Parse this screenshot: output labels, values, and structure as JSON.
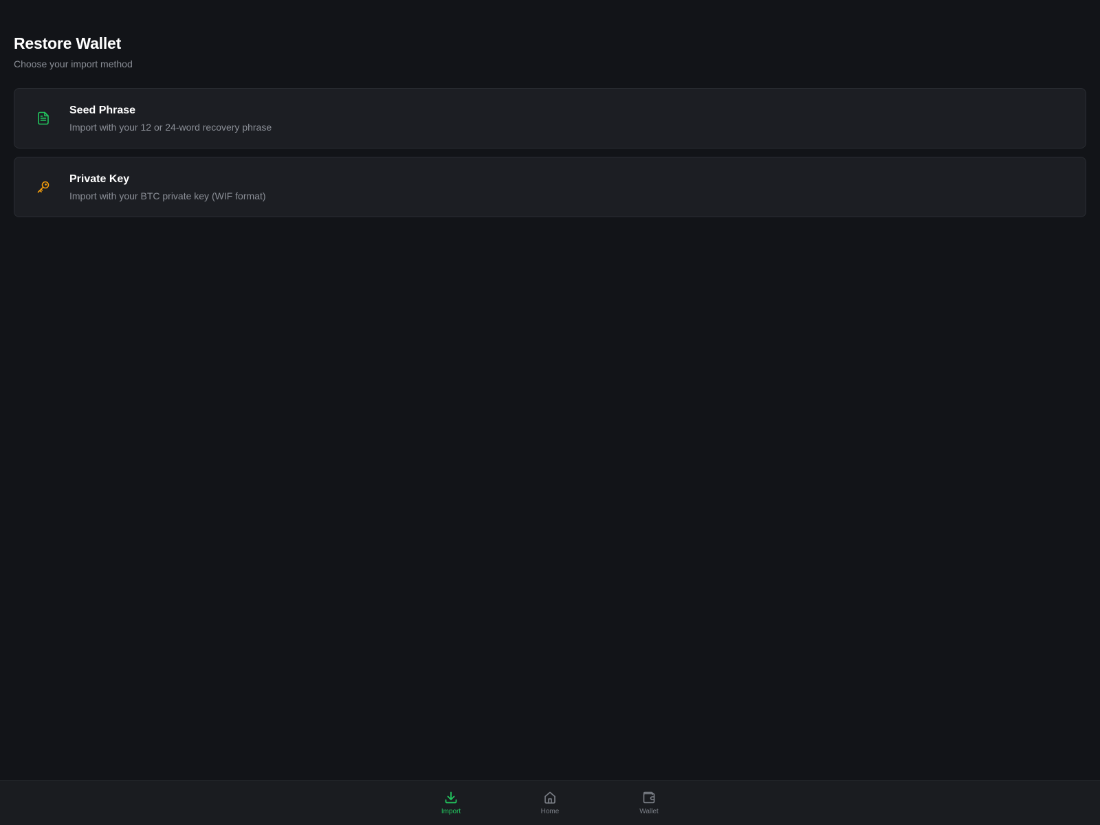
{
  "header": {
    "title": "Restore Wallet",
    "subtitle": "Choose your import method"
  },
  "options": [
    {
      "title": "Seed Phrase",
      "description": "Import with your 12 or 24-word recovery phrase",
      "icon": "document-icon",
      "icon_color": "#22c55e"
    },
    {
      "title": "Private Key",
      "description": "Import with your BTC private key (WIF format)",
      "icon": "key-icon",
      "icon_color": "#f59e0b"
    }
  ],
  "bottom_nav": {
    "active": "Import",
    "active_color": "#22c55e",
    "inactive_color": "#7d8189",
    "items": [
      {
        "label": "Import",
        "icon": "download-icon"
      },
      {
        "label": "Home",
        "icon": "home-icon"
      },
      {
        "label": "Wallet",
        "icon": "wallet-icon"
      }
    ]
  }
}
